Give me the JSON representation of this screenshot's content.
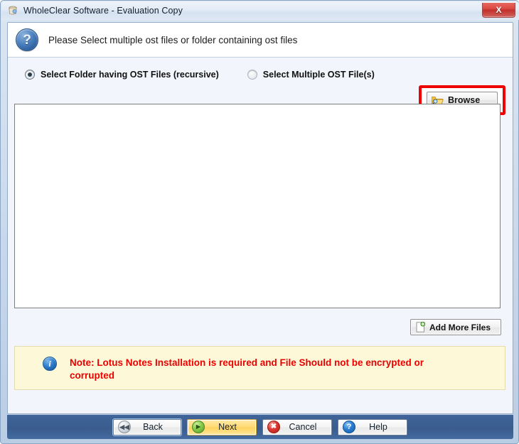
{
  "window": {
    "title": "WholeClear Software - Evaluation Copy",
    "app_icon": "app-icon",
    "close_label": "X"
  },
  "header": {
    "icon": "question-mark-icon",
    "instruction": "Please Select multiple ost files or folder containing ost files"
  },
  "options": {
    "radio_folder": {
      "label": "Select Folder having OST Files (recursive)",
      "selected": true
    },
    "radio_multiple": {
      "label": "Select Multiple OST File(s)",
      "selected": false
    }
  },
  "browse": {
    "label": "Browse",
    "icon": "folder-search-icon",
    "highlight_color": "#ee0000"
  },
  "file_list": {
    "items": []
  },
  "add_more": {
    "label": "Add More Files",
    "icon": "page-add-icon"
  },
  "note": {
    "icon": "info-icon",
    "icon_glyph": "i",
    "text": "Note: Lotus Notes Installation is required and File Should not be encrypted or corrupted",
    "text_color": "#ee0000",
    "background": "#fcf8d8"
  },
  "footer": {
    "buttons": [
      {
        "label": "Back",
        "icon": "rewind-icon",
        "glyph": "◀◀"
      },
      {
        "label": "Next",
        "icon": "play-icon",
        "glyph": "▶"
      },
      {
        "label": "Cancel",
        "icon": "cancel-icon",
        "glyph": "✖"
      },
      {
        "label": "Help",
        "icon": "help-icon",
        "glyph": "?"
      }
    ],
    "background": "#3a5c8d"
  }
}
